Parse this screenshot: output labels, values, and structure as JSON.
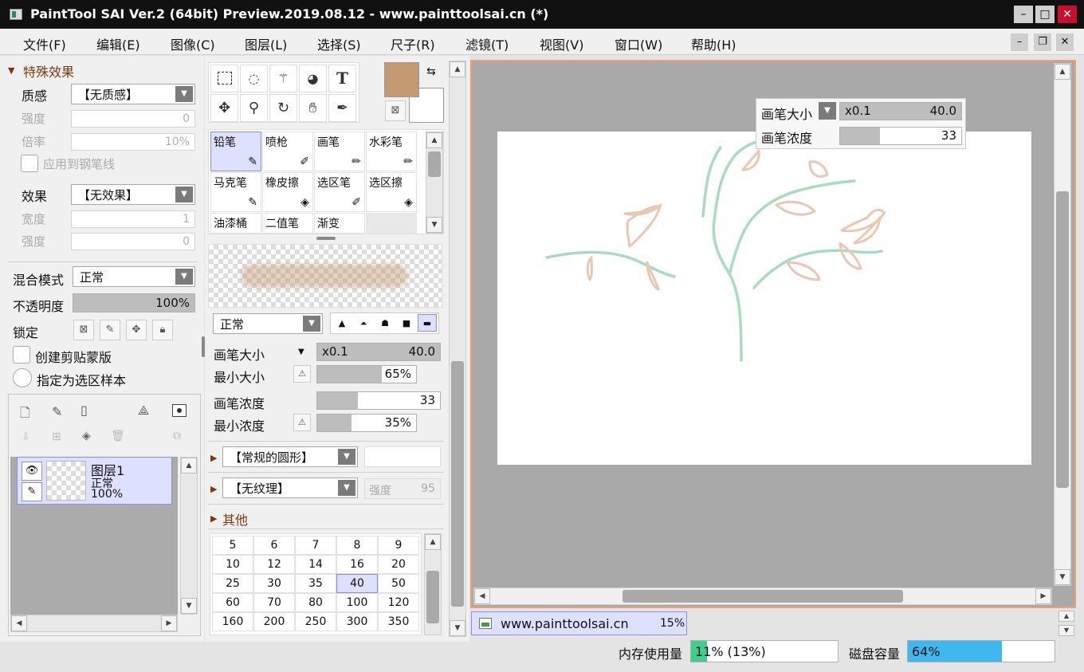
{
  "window": {
    "title": "PaintTool SAI Ver.2 (64bit) Preview.2019.08.12 - www.painttoolsai.cn (*)",
    "minimize": "–",
    "maximize": "□",
    "close": "✕"
  },
  "menu": [
    "文件(F)",
    "编辑(E)",
    "图像(C)",
    "图层(L)",
    "选择(S)",
    "尺子(R)",
    "滤镜(T)",
    "视图(V)",
    "窗口(W)",
    "帮助(H)"
  ],
  "mdi_buttons": {
    "minimize": "–",
    "restore": "❐",
    "close": "✕"
  },
  "effects": {
    "header": "特殊效果",
    "texture_label": "质感",
    "texture_value": "【无质感】",
    "strength_label": "强度",
    "strength_value": "0",
    "scale_label": "倍率",
    "scale_value": "10%",
    "apply_pen_label": "应用到钢笔线",
    "effect_label": "效果",
    "effect_value": "【无效果】",
    "width_label": "宽度",
    "width_value": "1",
    "strength2_label": "强度",
    "strength2_value": "0"
  },
  "layer_props": {
    "blend_label": "混合模式",
    "blend_value": "正常",
    "opacity_label": "不透明度",
    "opacity_value": "100%",
    "opacity_fraction": 1.0,
    "lock_label": "锁定",
    "clip_label": "创建剪贴蒙版",
    "sample_label": "指定为选区样本"
  },
  "layers": [
    {
      "name": "图层1",
      "mode": "正常",
      "opacity": "100%"
    }
  ],
  "colors": {
    "primary": "#c49a72",
    "secondary": "#ffffff",
    "accent": "#8a8af0",
    "canvas_bg": "#a9a9a9",
    "memory_fill": "#3ecf8e",
    "disk_fill": "#3fb8f0"
  },
  "tools": {
    "row1": [
      "rect-select-icon",
      "lasso-icon",
      "magic-wand-icon",
      "bucket-select-icon",
      "text-tool-icon"
    ],
    "row2": [
      "move-icon",
      "zoom-icon",
      "rotate-icon",
      "hand-icon",
      "eyedropper-icon"
    ],
    "text_tool_glyph": "T"
  },
  "brushes": [
    {
      "name": "铅笔",
      "selected": true
    },
    {
      "name": "喷枪",
      "selected": false
    },
    {
      "name": "画笔",
      "selected": false
    },
    {
      "name": "水彩笔",
      "selected": false
    },
    {
      "name": "马克笔",
      "selected": false
    },
    {
      "name": "橡皮擦",
      "selected": false
    },
    {
      "name": "选区笔",
      "selected": false
    },
    {
      "name": "选区擦",
      "selected": false
    },
    {
      "name": "油漆桶",
      "selected": false
    },
    {
      "name": "二值笔",
      "selected": false
    },
    {
      "name": "渐变",
      "selected": false
    }
  ],
  "brush_settings": {
    "blend_value": "正常",
    "size_label": "画笔大小",
    "size_mult": "x0.1",
    "size_value": "40.0",
    "size_fraction": 1.0,
    "min_size_label": "最小大小",
    "min_size_value": "65%",
    "min_size_fraction": 0.65,
    "density_label": "画笔浓度",
    "density_value": "33",
    "density_fraction": 0.33,
    "min_density_label": "最小浓度",
    "min_density_value": "35%",
    "min_density_fraction": 0.35,
    "shape_value": "【常规的圆形】",
    "texture_value": "【无纹理】",
    "texture_strength_label": "强度",
    "texture_strength_value": "95",
    "other_label": "其他"
  },
  "size_presets": [
    "5",
    "6",
    "7",
    "8",
    "9",
    "10",
    "12",
    "14",
    "16",
    "20",
    "25",
    "30",
    "35",
    "40",
    "50",
    "60",
    "70",
    "80",
    "100",
    "120",
    "160",
    "200",
    "250",
    "300",
    "350"
  ],
  "selected_preset": "40",
  "overlay": {
    "size_label": "画笔大小",
    "size_mult": "x0.1",
    "size_value": "40.0",
    "density_label": "画笔浓度",
    "density_value": "33"
  },
  "document_tab": {
    "name": "www.painttoolsai.cn",
    "zoom": "15%"
  },
  "status": {
    "memory_label": "内存使用量",
    "memory_value": "11% (13%)",
    "memory_fraction": 0.11,
    "disk_label": "磁盘容量",
    "disk_value": "64%",
    "disk_fraction": 0.64
  }
}
